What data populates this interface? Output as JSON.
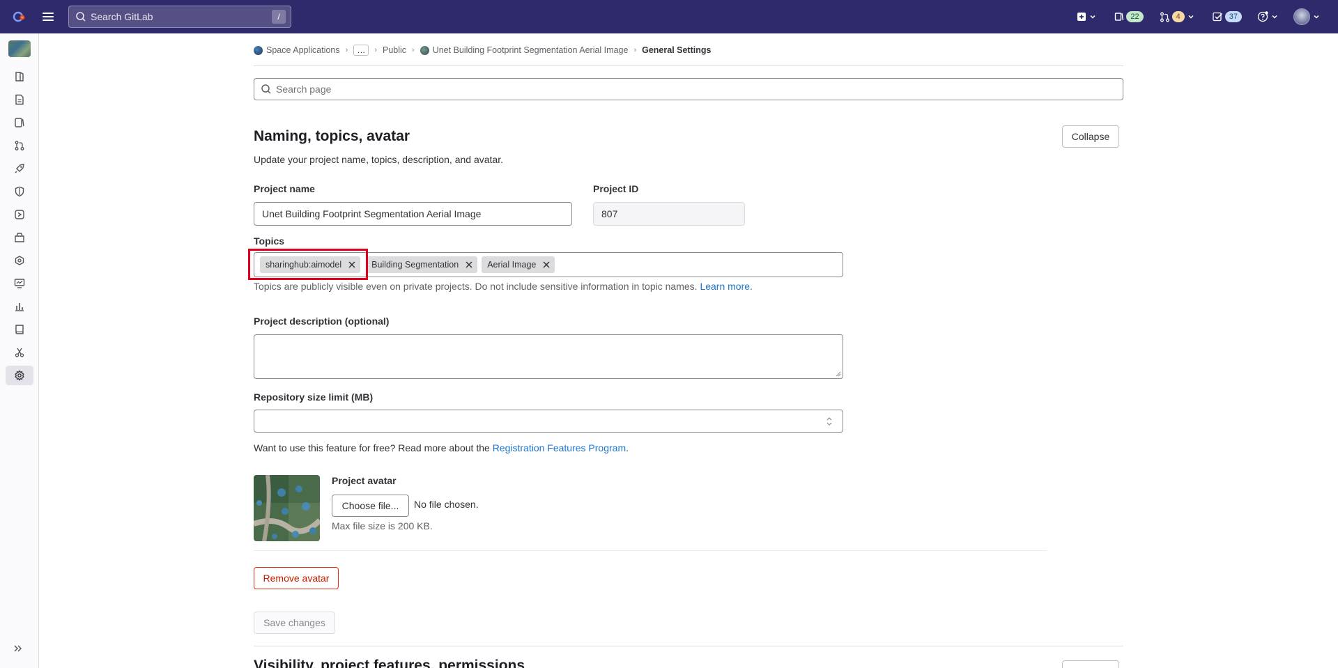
{
  "topbar": {
    "search_placeholder": "Search GitLab",
    "search_shortcut": "/",
    "issues_count": "22",
    "merge_requests_count": "4",
    "todos_count": "37"
  },
  "sidebar": {
    "items": [
      "project-overview",
      "repository",
      "issues",
      "merge-requests",
      "deployments",
      "security",
      "operations",
      "packages",
      "infrastructure",
      "monitor",
      "analytics",
      "wiki",
      "snippets",
      "settings"
    ],
    "active": "settings"
  },
  "breadcrumb": {
    "group": "Space Applications",
    "ellipsis": "…",
    "subgroup": "Public",
    "project": "Unet Building Footprint Segmentation Aerial Image",
    "current": "General Settings"
  },
  "page_search": {
    "placeholder": "Search page"
  },
  "section": {
    "title": "Naming, topics, avatar",
    "subtitle": "Update your project name, topics, description, and avatar.",
    "collapse_label": "Collapse"
  },
  "form": {
    "project_name_label": "Project name",
    "project_name_value": "Unet Building Footprint Segmentation Aerial Image",
    "project_id_label": "Project ID",
    "project_id_value": "807",
    "topics_label": "Topics",
    "topics": [
      "sharinghub:aimodel",
      "Building Segmentation",
      "Aerial Image"
    ],
    "topics_help": "Topics are publicly visible even on private projects. Do not include sensitive information in topic names.",
    "topics_help_link": "Learn more.",
    "description_label": "Project description (optional)",
    "repo_size_label": "Repository size limit (MB)",
    "repo_size_help": "Want to use this feature for free? Read more about the",
    "repo_size_help_link": "Registration Features Program",
    "repo_size_help_end": ".",
    "avatar_label": "Project avatar",
    "choose_file_label": "Choose file...",
    "file_status": "No file chosen.",
    "file_size_help": "Max file size is 200 KB.",
    "remove_avatar_label": "Remove avatar",
    "save_label": "Save changes"
  },
  "next_section": {
    "title": "Visibility, project features, permissions"
  }
}
